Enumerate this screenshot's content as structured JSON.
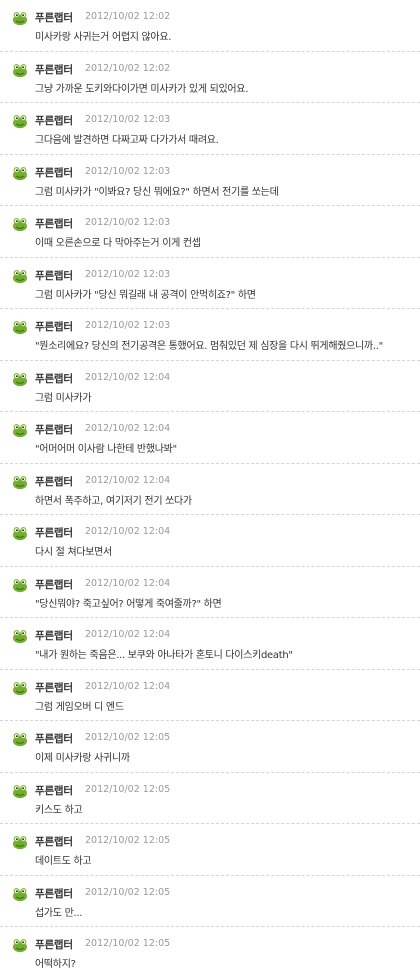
{
  "comments": [
    {
      "author": "푸른랩터",
      "time": "2012/10/02 12:02",
      "text": "미사카랑 사귀는거 어렵지 않아요.",
      "avatar_icon": "frog-avatar-icon"
    },
    {
      "author": "푸른랩터",
      "time": "2012/10/02 12:02",
      "text": "그냥 가까운 도키와다이가면 미사카가 있게 되있어요.",
      "avatar_icon": "frog-avatar-icon"
    },
    {
      "author": "푸른랩터",
      "time": "2012/10/02 12:03",
      "text": "그다음에 발견하면 다짜고짜 다가가서 때려요.",
      "avatar_icon": "frog-avatar-icon"
    },
    {
      "author": "푸른랩터",
      "time": "2012/10/02 12:03",
      "text": "그럼 미사카가 \"이봐요? 당신 뭐에요?\" 하면서 전기를 쏘는데",
      "avatar_icon": "frog-avatar-icon"
    },
    {
      "author": "푸른랩터",
      "time": "2012/10/02 12:03",
      "text": "이때 오른손으로 다 막아주는거 이게 컨셉",
      "avatar_icon": "frog-avatar-icon"
    },
    {
      "author": "푸른랩터",
      "time": "2012/10/02 12:03",
      "text": "그럼 미사카가 \"당신 뭐길래 내 공격이 안먹히죠?\" 하면",
      "avatar_icon": "frog-avatar-icon"
    },
    {
      "author": "푸른랩터",
      "time": "2012/10/02 12:03",
      "text": "\"뭔소리에요? 당신의 전기공격은 통했어요. 멈춰있던 제 심장을 다시 뛰게해줬으니까..\"",
      "avatar_icon": "frog-avatar-icon"
    },
    {
      "author": "푸른랩터",
      "time": "2012/10/02 12:04",
      "text": "그럼 미사카가",
      "avatar_icon": "frog-avatar-icon"
    },
    {
      "author": "푸른랩터",
      "time": "2012/10/02 12:04",
      "text": "\"어머어머 이사람 나한테 반했나봐\"",
      "avatar_icon": "frog-avatar-icon"
    },
    {
      "author": "푸른랩터",
      "time": "2012/10/02 12:04",
      "text": "하면서 폭주하고, 여기저기 전기 쏘다가",
      "avatar_icon": "frog-avatar-icon"
    },
    {
      "author": "푸른랩터",
      "time": "2012/10/02 12:04",
      "text": "다시 절 쳐다보면서",
      "avatar_icon": "frog-avatar-icon"
    },
    {
      "author": "푸른랩터",
      "time": "2012/10/02 12:04",
      "text": "\"당신뭐야? 죽고싶어? 어떻게 죽여줄까?\" 하면",
      "avatar_icon": "frog-avatar-icon"
    },
    {
      "author": "푸른랩터",
      "time": "2012/10/02 12:04",
      "text": "\"내가 원하는 죽음은... 보쿠와 아나타가 혼토니 다이스키death\"",
      "avatar_icon": "frog-avatar-icon"
    },
    {
      "author": "푸른랩터",
      "time": "2012/10/02 12:04",
      "text": "그럼 게임오버 디 엔드",
      "avatar_icon": "frog-avatar-icon"
    },
    {
      "author": "푸른랩터",
      "time": "2012/10/02 12:05",
      "text": "이제 미사카랑 사귀니까",
      "avatar_icon": "frog-avatar-icon"
    },
    {
      "author": "푸른랩터",
      "time": "2012/10/02 12:05",
      "text": "키스도 하고",
      "avatar_icon": "frog-avatar-icon"
    },
    {
      "author": "푸른랩터",
      "time": "2012/10/02 12:05",
      "text": "데이트도 하고",
      "avatar_icon": "frog-avatar-icon"
    },
    {
      "author": "푸른랩터",
      "time": "2012/10/02 12:05",
      "text": "섭가도 만...",
      "avatar_icon": "frog-avatar-icon"
    },
    {
      "author": "푸른랩터",
      "time": "2012/10/02 12:05",
      "text": "어떡하지?",
      "avatar_icon": "frog-avatar-icon"
    }
  ],
  "colors": {
    "avatar_green": "#6fae2c",
    "avatar_dark": "#2f6b14",
    "time_gray": "#9a9a9a",
    "divider": "#d4d4d4"
  }
}
